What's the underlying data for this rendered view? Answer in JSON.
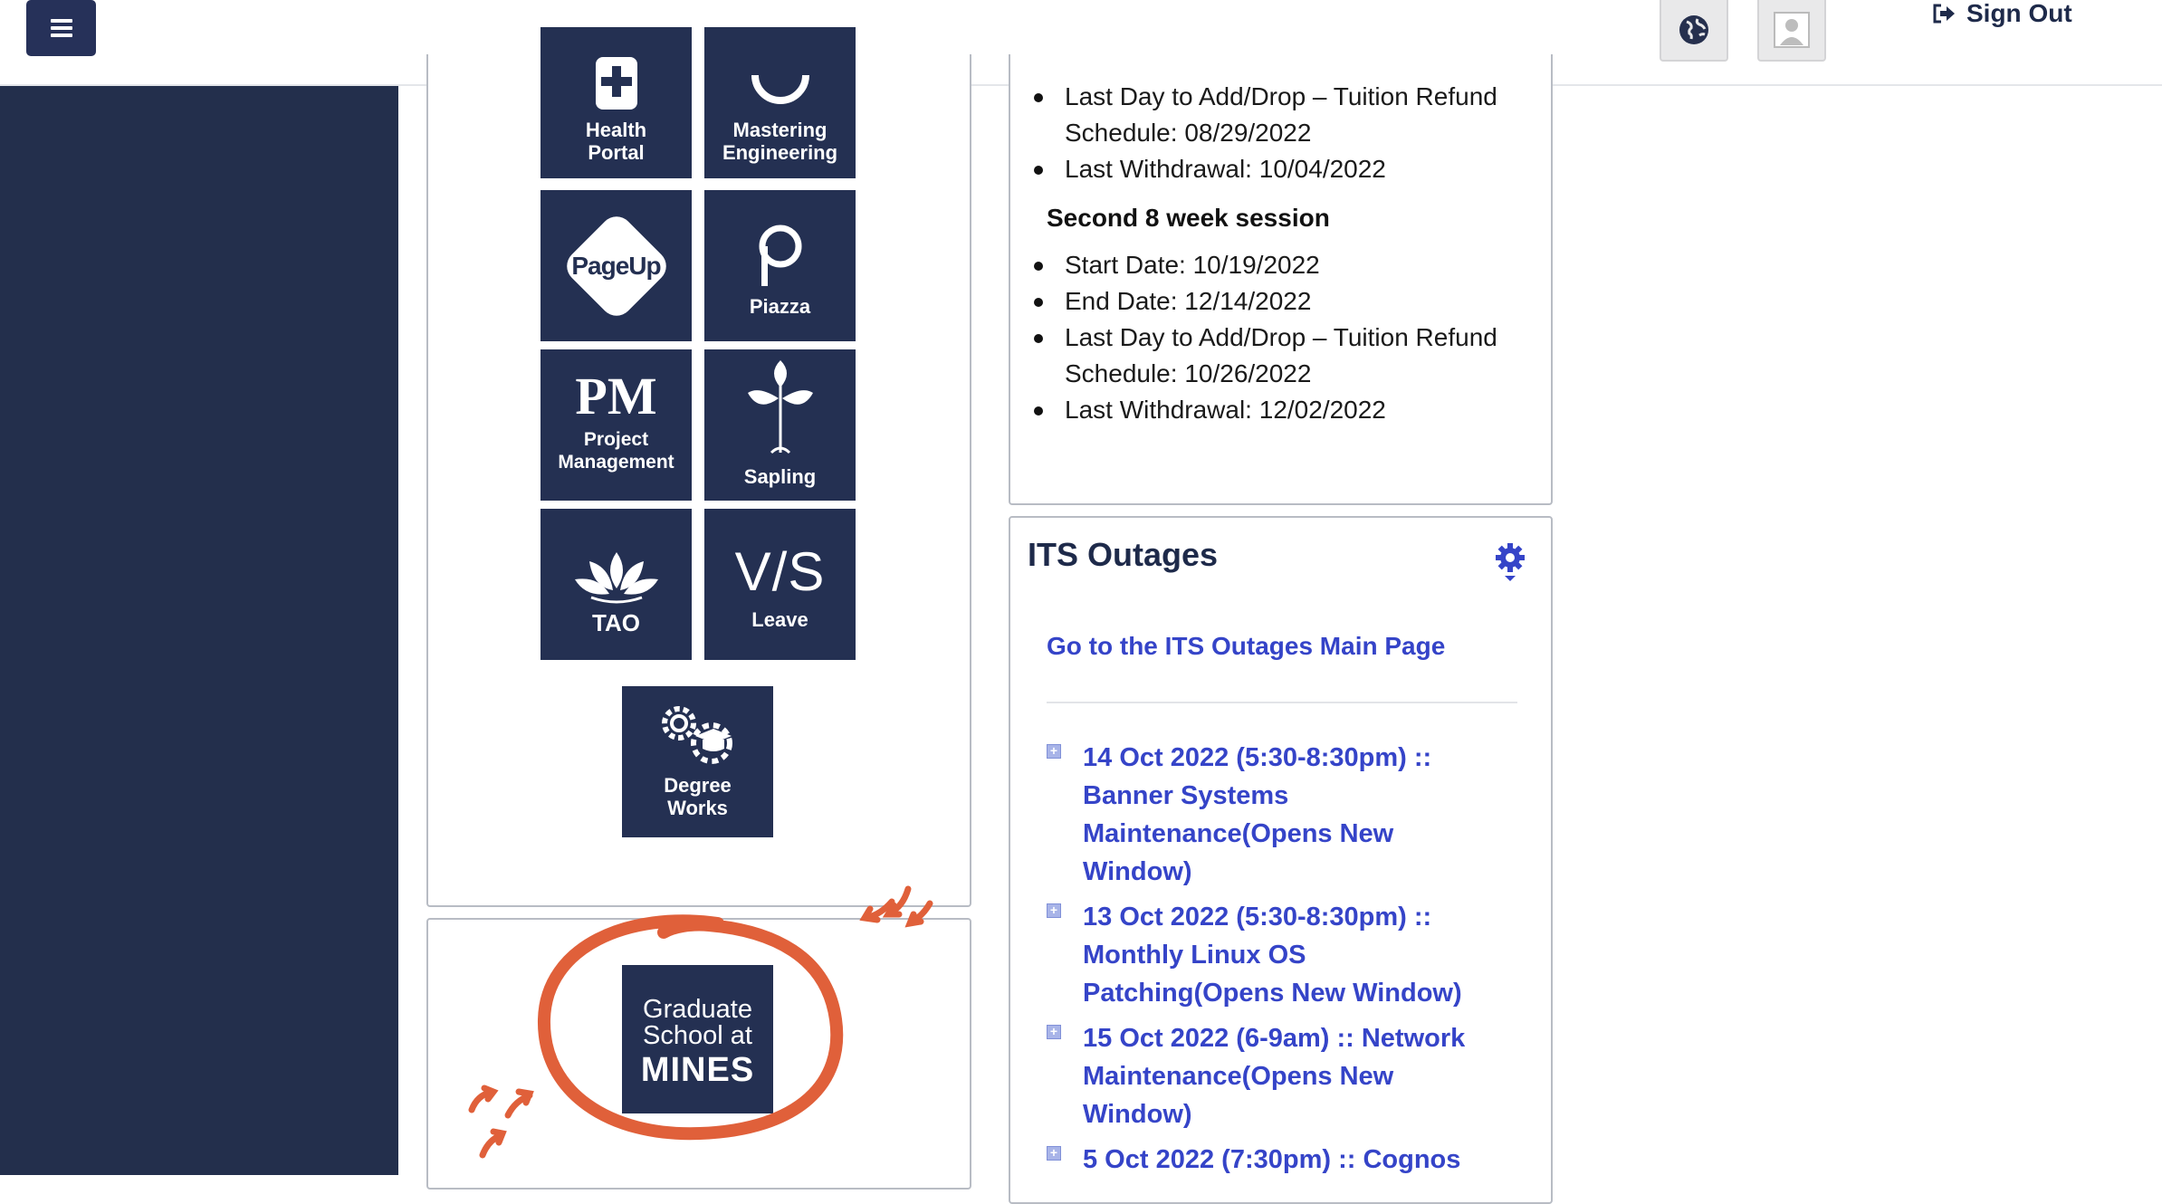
{
  "header": {
    "menu_icon": "hamburger-icon",
    "globe_icon": "globe-icon",
    "avatar_icon": "user-avatar-icon",
    "signout_icon": "sign-out-icon",
    "signout_label": "Sign Out"
  },
  "apps": {
    "tiles": [
      {
        "label1": "Health",
        "label2": "Portal",
        "icon": "health-plus-icon"
      },
      {
        "label1": "Mastering",
        "label2": "Engineering",
        "icon": "mastering-refresh-icon"
      },
      {
        "label1": "",
        "label2": "",
        "logo": "PageUp",
        "icon": "pageup-logo"
      },
      {
        "label1": "Piazza",
        "label2": "",
        "icon": "piazza-p-icon"
      },
      {
        "label1": "Project",
        "label2": "Management",
        "logo": "PM",
        "icon": "pm-logo"
      },
      {
        "label1": "Sapling",
        "label2": "",
        "icon": "sapling-sprout-icon"
      },
      {
        "label1": "TAO",
        "label2": "",
        "icon": "lotus-icon"
      },
      {
        "label1": "Leave",
        "label2": "",
        "logo": "V/S",
        "icon": "vs-logo"
      },
      {
        "label1": "Degree",
        "label2": "Works",
        "icon": "degree-works-gears-icon"
      }
    ]
  },
  "grad_school": {
    "line1": "Graduate",
    "line2": "School at",
    "line3": "MINES",
    "annotation_color": "#e0603a"
  },
  "calendar": {
    "first_items": [
      "Last Day to Add/Drop – Tuition Refund Schedule: 08/29/2022",
      "Last Withdrawal: 10/04/2022"
    ],
    "second_heading": "Second 8 week session",
    "second_items": [
      "Start Date: 10/19/2022",
      "End Date: 12/14/2022",
      "Last Day to Add/Drop – Tuition Refund Schedule: 10/26/2022",
      "Last Withdrawal: 12/02/2022"
    ]
  },
  "outages": {
    "title": "ITS Outages",
    "gear_icon": "gear-icon",
    "main_link": "Go to the ITS Outages Main Page",
    "items": [
      "14 Oct 2022 (5:30-8:30pm) :: Banner Systems Maintenance(Opens New Window)",
      "13 Oct 2022 (5:30-8:30pm) :: Monthly Linux OS Patching(Opens New Window)",
      "15 Oct 2022 (6-9am) :: Network Maintenance(Opens New Window)",
      "5 Oct 2022 (7:30pm) :: Cognos"
    ]
  },
  "colors": {
    "navy": "#243052",
    "link_blue": "#3544c8",
    "annotation": "#e0603a"
  }
}
